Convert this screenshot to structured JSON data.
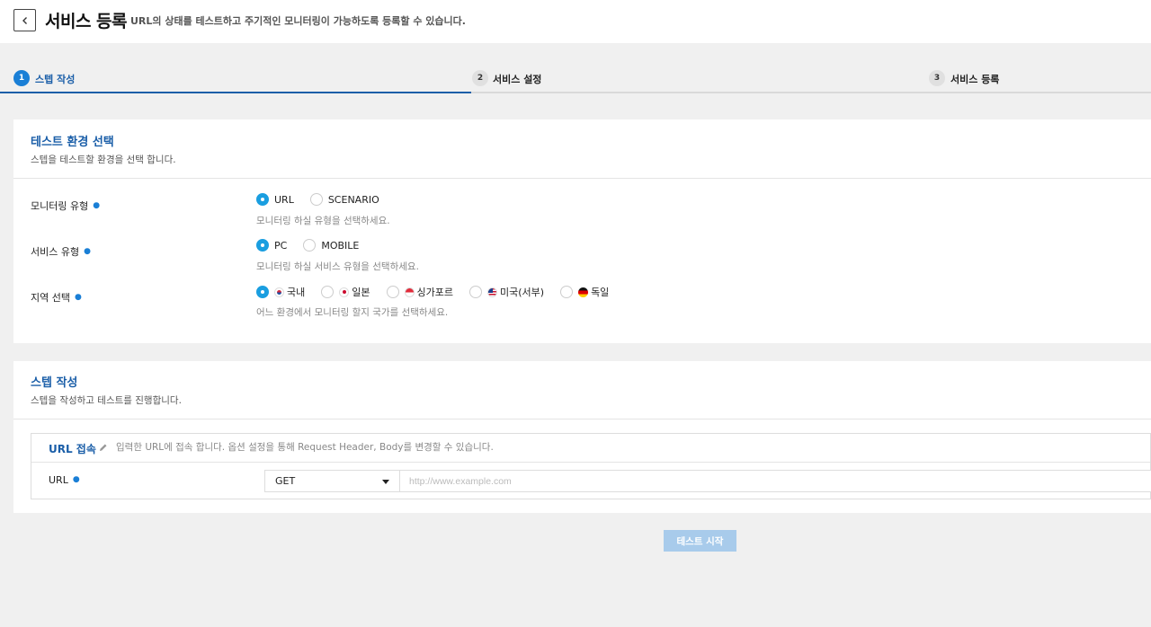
{
  "header": {
    "title": "서비스 등록",
    "description": "URL의 상태를 테스트하고 주기적인 모니터링이 가능하도록 등록할 수 있습니다."
  },
  "steps": [
    {
      "num": "1",
      "label": "스텝 작성",
      "active": true
    },
    {
      "num": "2",
      "label": "서비스 설정",
      "active": false
    },
    {
      "num": "3",
      "label": "서비스 등록",
      "active": false
    }
  ],
  "env_section": {
    "title": "테스트 환경 선택",
    "subtitle": "스텝을 테스트할 환경을 선택 합니다.",
    "monitoring_type": {
      "label": "모니터링 유형",
      "options": [
        "URL",
        "SCENARIO"
      ],
      "selected": "URL",
      "hint": "모니터링 하실 유형을 선택하세요."
    },
    "service_type": {
      "label": "서비스 유형",
      "options": [
        "PC",
        "MOBILE"
      ],
      "selected": "PC",
      "hint": "모니터링 하실 서비스 유형을 선택하세요."
    },
    "region": {
      "label": "지역 선택",
      "options": [
        "국내",
        "일본",
        "싱가포르",
        "미국(서부)",
        "독일"
      ],
      "selected": "국내",
      "hint": "어느 환경에서 모니터링 할지 국가를 선택하세요."
    }
  },
  "step_section": {
    "title": "스텝 작성",
    "subtitle": "스텝을 작성하고 테스트를 진행합니다.",
    "url_step": {
      "title": "URL 접속",
      "description": "입력한 URL에 접속 합니다. 옵션 설정을 통해 Request Header, Body를 변경할 수 있습니다.",
      "url_label": "URL",
      "method": "GET",
      "url_placeholder": "http://www.example.com"
    }
  },
  "actions": {
    "start_test": "테스트 시작"
  },
  "colors": {
    "accent": "#1a5ea8",
    "radio_on": "#1a9ee0",
    "button_disabled": "#a8cbeb"
  }
}
